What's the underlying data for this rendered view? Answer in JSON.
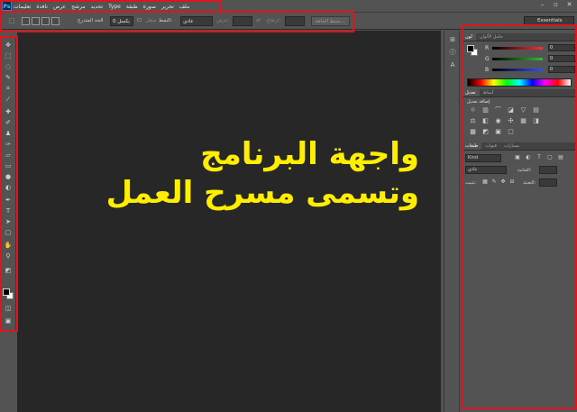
{
  "app": {
    "logo": "Ps"
  },
  "menu": [
    "تعليمات",
    "نافذة",
    "عرض",
    "مرشح",
    "تحديد",
    "Type",
    "طبقة",
    "صورة",
    "تحرير",
    "ملف"
  ],
  "window_controls": {
    "minimize": "–",
    "restore": "▫",
    "close": "✕"
  },
  "options": {
    "feather_label": "تيشن:",
    "feather_value": "0 بكسل",
    "anti_alias_label": "صقل",
    "style_label": "النمط:",
    "style_value": "عادي",
    "width_label": "عرض:",
    "height_label": "ارتفاع:",
    "refine_button": "ضبط الحافة...",
    "workspace": "Essentials",
    "remove_label": "الحد المتدرج"
  },
  "colors": {
    "fg": "#000000",
    "bg": "#ffffff",
    "annotation": "#e0141b",
    "caption": "#ffee00",
    "canvas": "#272727"
  },
  "tools": [
    "move-icon",
    "marquee-icon",
    "lasso-icon",
    "quick-select-icon",
    "crop-icon",
    "eyedropper-icon",
    "healing-icon",
    "brush-icon",
    "stamp-icon",
    "history-brush-icon",
    "eraser-icon",
    "gradient-icon",
    "blur-icon",
    "dodge-icon",
    "pen-icon",
    "type-icon",
    "path-select-icon",
    "shape-icon",
    "hand-icon",
    "zoom-icon",
    "quick-mask-icon",
    "screen-mode-icon"
  ],
  "canvas_text": {
    "line1": "واجهة البرنامج",
    "line2": "وتسمى مسرح العمل"
  },
  "color_panel": {
    "tabs": [
      "لون",
      "حامل الألوان"
    ],
    "channels": [
      {
        "label": "R",
        "value": "0",
        "color": "#ff3030"
      },
      {
        "label": "G",
        "value": "0",
        "color": "#30c030"
      },
      {
        "label": "B",
        "value": "0",
        "color": "#3050ff"
      }
    ]
  },
  "adjust_panel": {
    "tabs": [
      "تعديل",
      "أنماط"
    ],
    "title": "إضافة تعديل",
    "icons": [
      "brightness-icon",
      "levels-icon",
      "curves-icon",
      "exposure-icon",
      "vibrance-icon",
      "hue-icon",
      "balance-icon",
      "bw-icon",
      "photo-filter-icon",
      "mixer-icon",
      "lookup-icon",
      "invert-icon",
      "posterize-icon",
      "threshold-icon",
      "selective-color-icon",
      "gradient-map-icon"
    ]
  },
  "layers_panel": {
    "tabs": [
      "طبقات",
      "قنوات",
      "مسارات"
    ],
    "kind": "Kind",
    "blend_mode": "عادي",
    "opacity_label": "العتامة:",
    "lock_label": "تثبيت:",
    "fill_label": "التعبئة:"
  }
}
